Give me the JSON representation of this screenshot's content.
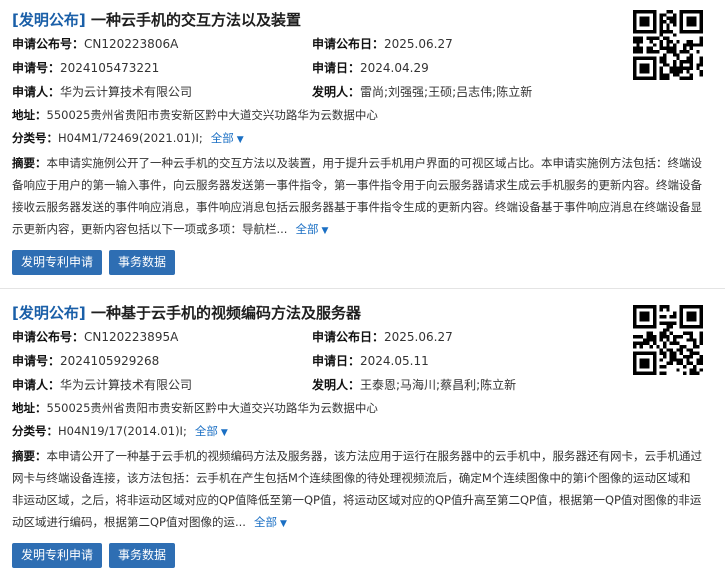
{
  "labels": {
    "pub_no": "申请公布号：",
    "pub_date": "申请公布日：",
    "app_no": "申请号：",
    "app_date": "申请日：",
    "applicant": "申请人：",
    "inventor": "发明人：",
    "address": "地址：",
    "classification": "分类号：",
    "abstract": "摘要：",
    "expand": "全部",
    "btn_apply": "发明专利申请",
    "btn_affairs": "事务数据"
  },
  "patents": [
    {
      "tag": "[发明公布]",
      "title": "一种云手机的交互方法以及装置",
      "pub_no": "CN120223806A",
      "pub_date": "2025.06.27",
      "app_no": "2024105473221",
      "app_date": "2024.04.29",
      "applicant": "华为云计算技术有限公司",
      "inventor": "雷尚;刘强强;王硕;吕志伟;陈立新",
      "address": "550025贵州省贵阳市贵安新区黔中大道交兴功路华为云数据中心",
      "classification": "H04M1/72469(2021.01)I;",
      "abstract": "本申请实施例公开了一种云手机的交互方法以及装置，用于提升云手机用户界面的可视区域占比。本申请实施例方法包括：终端设备响应于用户的第一输入事件，向云服务器发送第一事件指令，第一事件指令用于向云服务器请求生成云手机服务的更新内容。终端设备接收云服务器发送的事件响应消息，事件响应消息包括云服务器基于事件指令生成的更新内容。终端设备基于事件响应消息在终端设备显示更新内容，更新内容包括以下一项或多项：导航栏..."
    },
    {
      "tag": "[发明公布]",
      "title": "一种基于云手机的视频编码方法及服务器",
      "pub_no": "CN120223895A",
      "pub_date": "2025.06.27",
      "app_no": "2024105929268",
      "app_date": "2024.05.11",
      "applicant": "华为云计算技术有限公司",
      "inventor": "王泰恩;马海川;蔡昌利;陈立新",
      "address": "550025贵州省贵阳市贵安新区黔中大道交兴功路华为云数据中心",
      "classification": "H04N19/17(2014.01)I;",
      "abstract": "本申请公开了一种基于云手机的视频编码方法及服务器，该方法应用于运行在服务器中的云手机中，服务器还有网卡，云手机通过网卡与终端设备连接，该方法包括：云手机在产生包括M个连续图像的待处理视频流后，确定M个连续图像中的第i个图像的运动区域和非运动区域，之后，将非运动区域对应的QP值降低至第一QP值，将运动区域对应的QP值升高至第二QP值，根据第一QP值对图像的非运动区域进行编码，根据第二QP值对图像的运..."
    }
  ]
}
